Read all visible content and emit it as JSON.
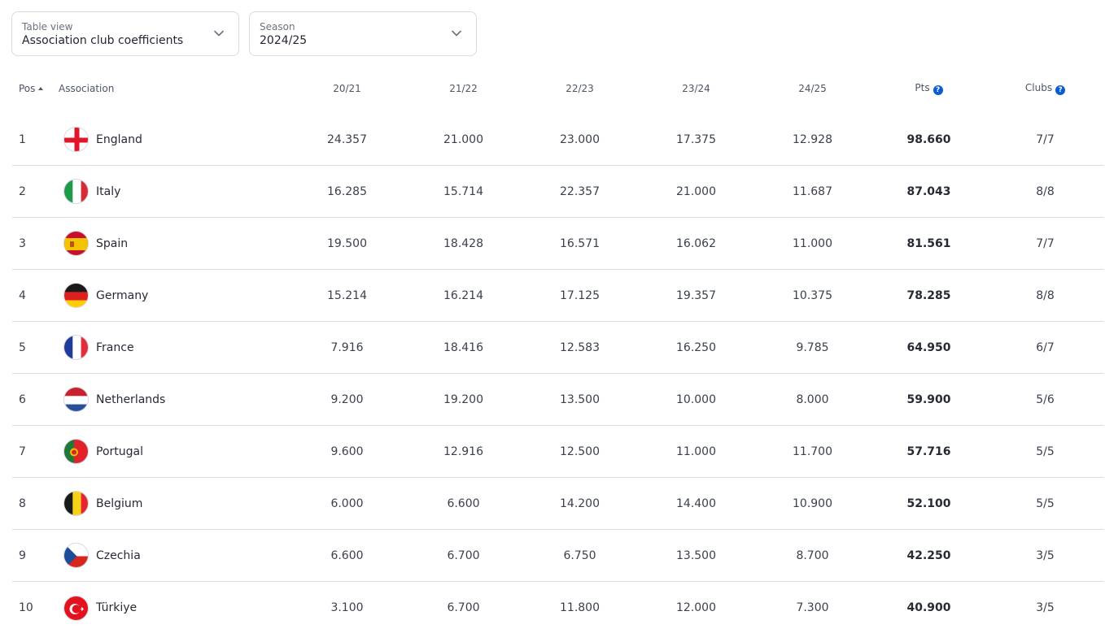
{
  "filters": {
    "table_view": {
      "label": "Table view",
      "value": "Association club coefficients"
    },
    "season": {
      "label": "Season",
      "value": "2024/25"
    }
  },
  "columns": {
    "pos": "Pos",
    "association": "Association",
    "s1": "20/21",
    "s2": "21/22",
    "s3": "22/23",
    "s4": "23/24",
    "s5": "24/25",
    "pts": "Pts",
    "clubs": "Clubs"
  },
  "rows": [
    {
      "pos": "1",
      "name": "England",
      "flag": "england-flag-icon",
      "s1": "24.357",
      "s2": "21.000",
      "s3": "23.000",
      "s4": "17.375",
      "s5": "12.928",
      "pts": "98.660",
      "clubs": "7/7"
    },
    {
      "pos": "2",
      "name": "Italy",
      "flag": "italy-flag-icon",
      "s1": "16.285",
      "s2": "15.714",
      "s3": "22.357",
      "s4": "21.000",
      "s5": "11.687",
      "pts": "87.043",
      "clubs": "8/8"
    },
    {
      "pos": "3",
      "name": "Spain",
      "flag": "spain-flag-icon",
      "s1": "19.500",
      "s2": "18.428",
      "s3": "16.571",
      "s4": "16.062",
      "s5": "11.000",
      "pts": "81.561",
      "clubs": "7/7"
    },
    {
      "pos": "4",
      "name": "Germany",
      "flag": "germany-flag-icon",
      "s1": "15.214",
      "s2": "16.214",
      "s3": "17.125",
      "s4": "19.357",
      "s5": "10.375",
      "pts": "78.285",
      "clubs": "8/8"
    },
    {
      "pos": "5",
      "name": "France",
      "flag": "france-flag-icon",
      "s1": "7.916",
      "s2": "18.416",
      "s3": "12.583",
      "s4": "16.250",
      "s5": "9.785",
      "pts": "64.950",
      "clubs": "6/7"
    },
    {
      "pos": "6",
      "name": "Netherlands",
      "flag": "netherlands-flag-icon",
      "s1": "9.200",
      "s2": "19.200",
      "s3": "13.500",
      "s4": "10.000",
      "s5": "8.000",
      "pts": "59.900",
      "clubs": "5/6"
    },
    {
      "pos": "7",
      "name": "Portugal",
      "flag": "portugal-flag-icon",
      "s1": "9.600",
      "s2": "12.916",
      "s3": "12.500",
      "s4": "11.000",
      "s5": "11.700",
      "pts": "57.716",
      "clubs": "5/5"
    },
    {
      "pos": "8",
      "name": "Belgium",
      "flag": "belgium-flag-icon",
      "s1": "6.000",
      "s2": "6.600",
      "s3": "14.200",
      "s4": "14.400",
      "s5": "10.900",
      "pts": "52.100",
      "clubs": "5/5"
    },
    {
      "pos": "9",
      "name": "Czechia",
      "flag": "czechia-flag-icon",
      "s1": "6.600",
      "s2": "6.700",
      "s3": "6.750",
      "s4": "13.500",
      "s5": "8.700",
      "pts": "42.250",
      "clubs": "3/5"
    },
    {
      "pos": "10",
      "name": "Türkiye",
      "flag": "turkiye-flag-icon",
      "s1": "3.100",
      "s2": "6.700",
      "s3": "11.800",
      "s4": "12.000",
      "s5": "7.300",
      "pts": "40.900",
      "clubs": "3/5"
    }
  ],
  "colors": {
    "accent": "#0b5bd3",
    "divider": "#d9dce2"
  }
}
